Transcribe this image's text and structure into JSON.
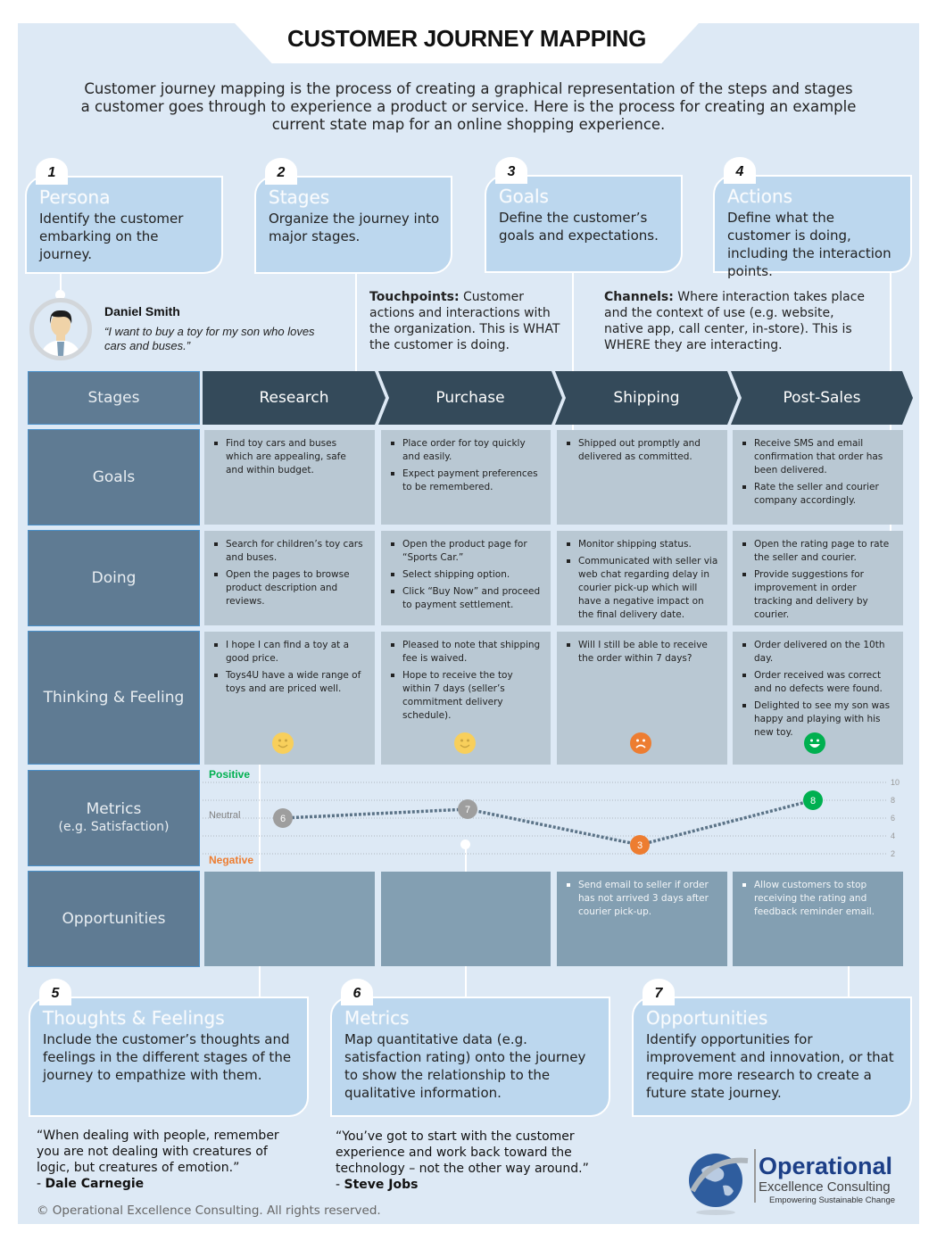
{
  "header": {
    "title": "CUSTOMER JOURNEY MAPPING",
    "intro": "Customer journey mapping is the process of creating a graphical representation of the steps and stages a customer goes through to experience a product or service. Here is the process for creating an example current state map for an online shopping experience."
  },
  "steps": [
    {
      "number": "1",
      "title": "Persona",
      "body": "Identify the customer embarking on the journey."
    },
    {
      "number": "2",
      "title": "Stages",
      "body": "Organize the journey into major stages."
    },
    {
      "number": "3",
      "title": "Goals",
      "body": "Define the customer’s goals and expectations."
    },
    {
      "number": "4",
      "title": "Actions",
      "body": "Define what the customer is doing, including the interaction points."
    },
    {
      "number": "5",
      "title": "Thoughts & Feelings",
      "body": "Include the customer’s thoughts and feelings in the different stages of the journey to empathize with them."
    },
    {
      "number": "6",
      "title": "Metrics",
      "body": "Map quantitative data (e.g. satisfaction rating) onto the journey to show the relationship to the qualitative information."
    },
    {
      "number": "7",
      "title": "Opportunities",
      "body": "Identify opportunities for improvement and innovation, or that require more research to create a future state journey."
    }
  ],
  "persona": {
    "name": "Daniel Smith",
    "quote": "“I want to buy a toy for my son who loves cars and buses.”"
  },
  "notes": {
    "touchpoints_label": "Touchpoints:",
    "touchpoints_text": " Customer actions and interactions with the organization. This is WHAT the customer is doing.",
    "channels_label": "Channels:",
    "channels_text": " Where interaction takes place and the context of use (e.g. website, native app, call center, in-store). This is WHERE they are interacting."
  },
  "rows": {
    "stages": "Stages",
    "goals": "Goals",
    "doing": "Doing",
    "thinking": "Thinking & Feeling",
    "metrics": "Metrics",
    "metrics_sub": "(e.g. Satisfaction)",
    "opportunities": "Opportunities"
  },
  "stages": [
    "Research",
    "Purchase",
    "Shipping",
    "Post-Sales"
  ],
  "goals": [
    [
      "Find toy cars and buses which are appealing, safe and within budget."
    ],
    [
      "Place order for toy quickly and easily.",
      "Expect payment preferences to be remembered."
    ],
    [
      "Shipped out promptly and delivered as committed."
    ],
    [
      "Receive SMS and email confirmation that order has been delivered.",
      "Rate the seller and courier company accordingly."
    ]
  ],
  "doing": [
    [
      "Search for children’s toy cars and buses.",
      "Open the pages to browse product description and reviews."
    ],
    [
      "Open the product page for “Sports Car.”",
      "Select shipping option.",
      "Click “Buy Now” and proceed to payment settlement."
    ],
    [
      "Monitor shipping status.",
      "Communicated with seller via web chat regarding delay in courier pick-up which will have a negative impact on the final delivery date."
    ],
    [
      "Open the rating page to rate the seller and courier.",
      "Provide suggestions for improvement in order tracking and delivery by courier."
    ]
  ],
  "thinking": [
    {
      "items": [
        "I hope I can find a toy at a good price.",
        "Toys4U have a wide range of toys and are priced well."
      ],
      "mood": "smile-icon",
      "color": "#f8cf5b"
    },
    {
      "items": [
        "Pleased to note that shipping fee is waived.",
        "Hope to receive the toy within 7 days (seller’s commitment delivery schedule)."
      ],
      "mood": "smile-icon",
      "color": "#f8cf5b"
    },
    {
      "items": [
        "Will I still be able to receive the order within 7 days?"
      ],
      "mood": "frown-icon",
      "color": "#ed7d31"
    },
    {
      "items": [
        "Order delivered on the 10th day.",
        "Order received was correct and no defects were found.",
        "Delighted to see my son was happy and playing with his new toy."
      ],
      "mood": "grin-icon",
      "color": "#00b050"
    }
  ],
  "opportunities": [
    [],
    [],
    [
      "Send email to seller if order has not arrived 3 days after courier pick-up."
    ],
    [
      "Allow customers to stop receiving the rating and feedback reminder email."
    ]
  ],
  "chart_data": {
    "type": "line",
    "categories": [
      "Research",
      "Purchase",
      "Shipping",
      "Post-Sales"
    ],
    "values": [
      6,
      7,
      3,
      8
    ],
    "point_colors": [
      "#9e9e9e",
      "#9e9e9e",
      "#ed7d31",
      "#00b050"
    ],
    "ylim": [
      0,
      10
    ],
    "yticks": [
      2,
      4,
      6,
      8,
      10
    ],
    "labels": {
      "positive": "Positive",
      "neutral": "Neutral",
      "negative": "Negative"
    },
    "label_colors": {
      "positive": "#00b050",
      "neutral": "#7f7f7f",
      "negative": "#ed7d31"
    },
    "line_color": "#5b7387",
    "line_style": "dotted",
    "grid": true
  },
  "quotes": [
    {
      "text": "“When dealing with people, remember you are not dealing with creatures of logic, but creatures of emotion.”",
      "author": "Dale Carnegie"
    },
    {
      "text": "“You’ve got to start with the customer experience and work back toward the technology – not the other way around.”",
      "author": "Steve Jobs"
    }
  ],
  "footer": {
    "copyright": "© Operational Excellence Consulting. All rights reserved."
  },
  "logo": {
    "name": "Operational",
    "sub": "Excellence Consulting",
    "tagline": "Empowering Sustainable Change",
    "icon": "globe-icon"
  }
}
